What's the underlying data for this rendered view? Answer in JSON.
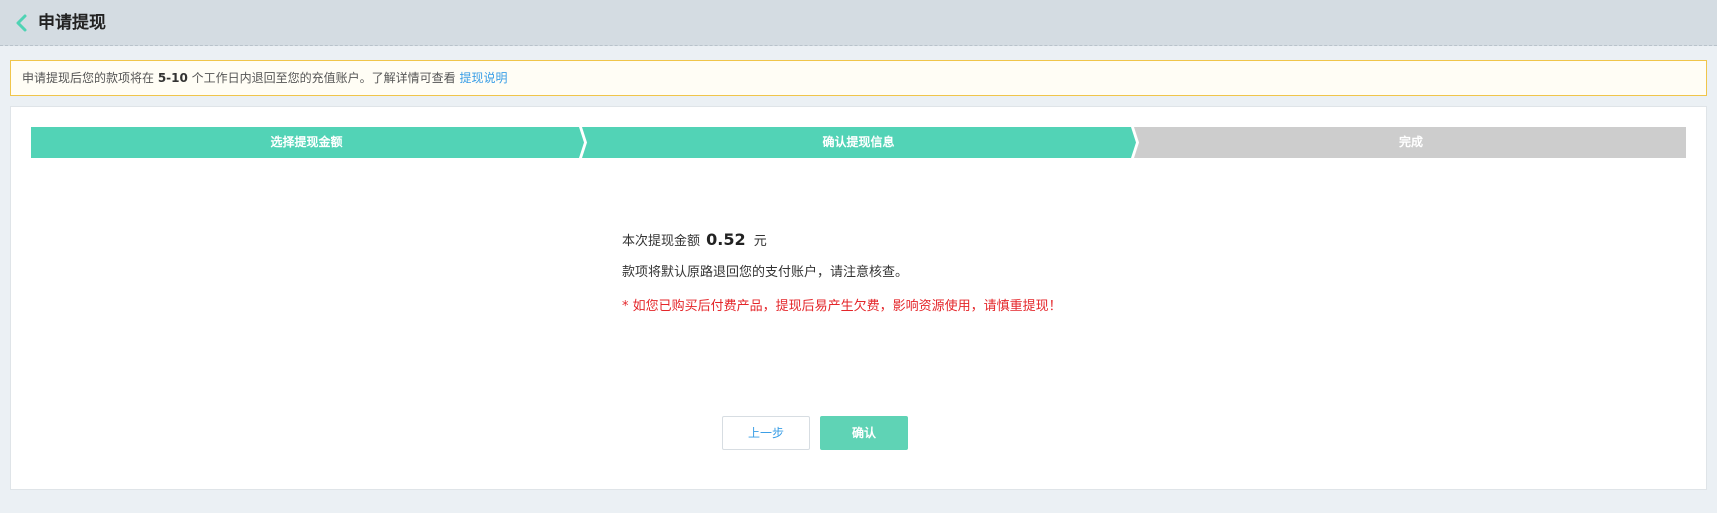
{
  "header": {
    "title": "申请提现",
    "back_icon": "chevron-left-icon",
    "back_icon_color": "#4fd3b4"
  },
  "notice": {
    "text_before": "申请提现后您的款项将在 ",
    "days": "5-10",
    "text_after": " 个工作日内退回至您的充值账户。了解详情可查看 ",
    "link": "提现说明"
  },
  "steps": {
    "items": [
      {
        "label": "选择提现金额",
        "status": "done"
      },
      {
        "label": "确认提现信息",
        "status": "current"
      },
      {
        "label": "完成",
        "status": "pending"
      }
    ],
    "active_color": "#52d3b6",
    "inactive_color": "#cdcdcd"
  },
  "content": {
    "amount_prefix": "本次提现金额",
    "amount_value": "0.52",
    "amount_unit": "元",
    "info": "款项将默认原路退回您的支付账户，请注意核查。",
    "warning": "* 如您已购买后付费产品，提现后易产生欠费，影响资源使用，请慎重提现！",
    "warning_color": "#e4262a"
  },
  "buttons": {
    "prev_label": "上一步",
    "confirm_label": "确认"
  }
}
